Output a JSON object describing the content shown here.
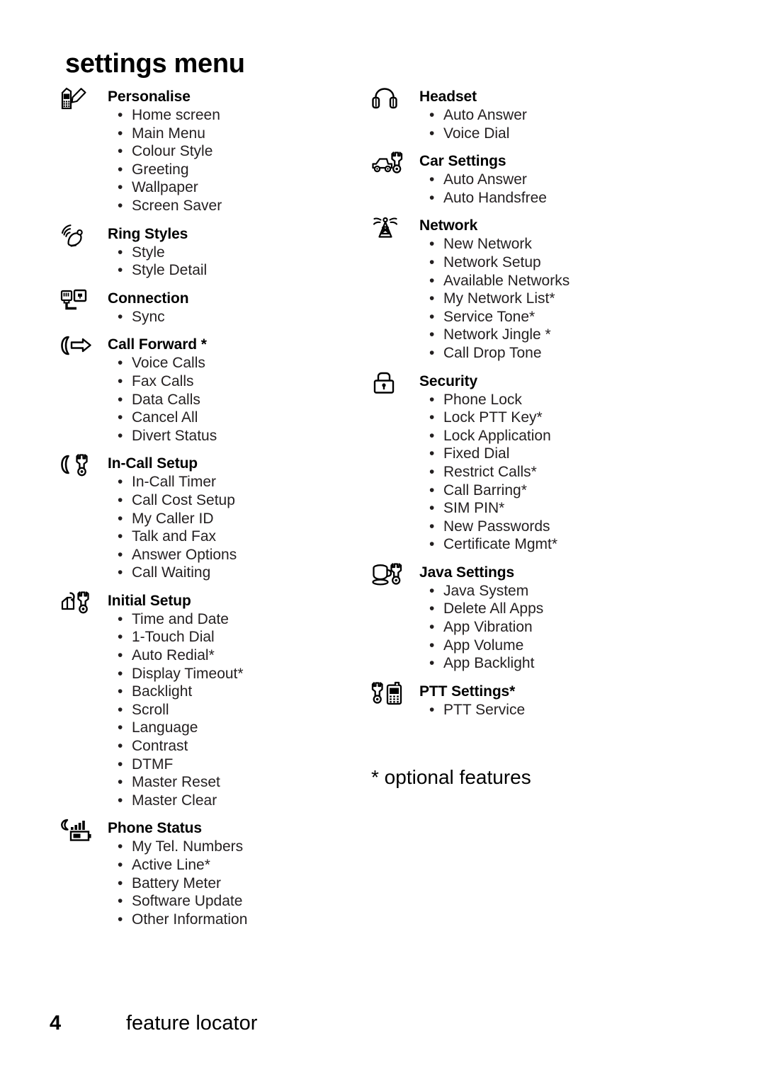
{
  "document": {
    "title": "settings menu",
    "footnote": "* optional features",
    "footer": {
      "page_number": "4",
      "section": "feature locator"
    }
  },
  "left_column": [
    {
      "icon": "phone-pencil-icon",
      "heading": "Personalise",
      "items": [
        "Home screen",
        "Main Menu",
        "Colour Style",
        "Greeting",
        "Wallpaper",
        "Screen Saver"
      ]
    },
    {
      "icon": "ringing-bell-icon",
      "heading": "Ring Styles",
      "items": [
        "Style",
        "Style Detail"
      ]
    },
    {
      "icon": "connection-plug-icon",
      "heading": "Connection",
      "items": [
        "Sync"
      ]
    },
    {
      "icon": "call-forward-arrow-icon",
      "heading": "Call Forward *",
      "items": [
        "Voice Calls",
        "Fax Calls",
        "Data Calls",
        "Cancel All",
        "Divert Status"
      ]
    },
    {
      "icon": "handset-wrench-icon",
      "heading": "In-Call Setup",
      "items": [
        "In-Call Timer",
        "Call Cost Setup",
        "My Caller ID",
        "Talk and Fax",
        "Answer Options",
        "Call Waiting"
      ]
    },
    {
      "icon": "box-wrench-icon",
      "heading": "Initial Setup",
      "items": [
        "Time and Date",
        "1-Touch Dial",
        "Auto Redial*",
        "Display Timeout*",
        "Backlight",
        "Scroll",
        "Language",
        "Contrast",
        "DTMF",
        "Master Reset",
        "Master Clear"
      ]
    },
    {
      "icon": "signal-battery-icon",
      "heading": "Phone Status",
      "items": [
        "My Tel. Numbers",
        "Active Line*",
        "Battery Meter",
        "Software Update",
        "Other Information"
      ]
    }
  ],
  "right_column": [
    {
      "icon": "headphones-icon",
      "heading": "Headset",
      "items": [
        "Auto Answer",
        "Voice Dial"
      ]
    },
    {
      "icon": "car-wrench-icon",
      "heading": "Car Settings",
      "items": [
        "Auto Answer",
        "Auto Handsfree"
      ]
    },
    {
      "icon": "antenna-tower-icon",
      "heading": "Network",
      "items": [
        "New Network",
        "Network Setup",
        "Available Networks",
        "My Network List*",
        "Service Tone*",
        "Network Jingle *",
        "Call Drop Tone"
      ]
    },
    {
      "icon": "padlock-icon",
      "heading": "Security",
      "items": [
        "Phone Lock",
        "Lock PTT Key*",
        "Lock Application",
        "Fixed Dial",
        "Restrict Calls*",
        "Call Barring*",
        "SIM PIN*",
        "New Passwords",
        "Certificate Mgmt*"
      ]
    },
    {
      "icon": "coffee-cup-wrench-icon",
      "heading": "Java Settings",
      "items": [
        "Java System",
        "Delete All Apps",
        "App Vibration",
        "App Volume",
        "App Backlight"
      ]
    },
    {
      "icon": "wrench-walkie-talkie-icon",
      "heading": "PTT Settings*",
      "items": [
        "PTT Service"
      ]
    }
  ],
  "bullet_glyph": "•",
  "colors": {
    "text": "#000000",
    "list_text": "#231f20",
    "background": "#ffffff"
  }
}
